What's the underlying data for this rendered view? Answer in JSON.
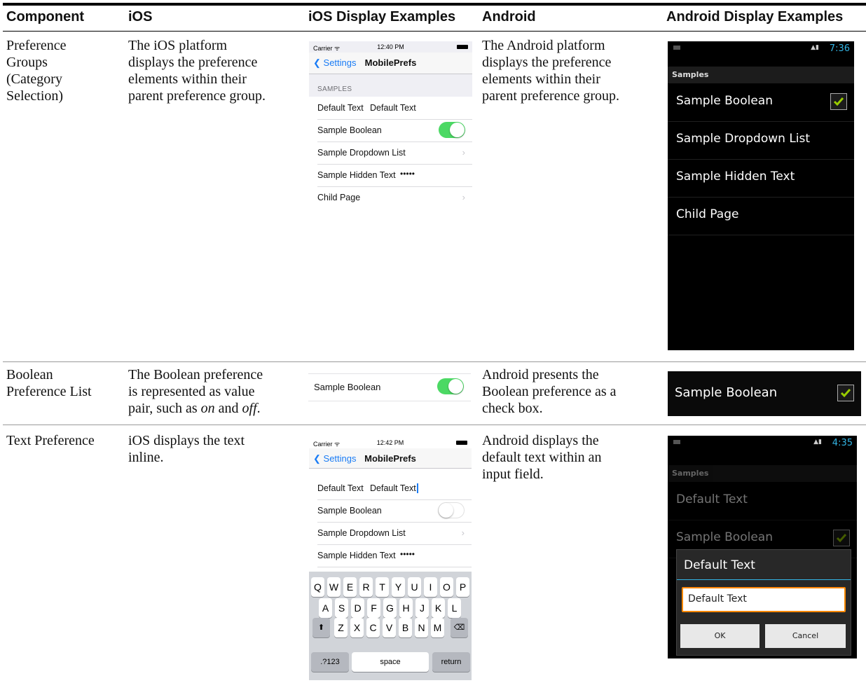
{
  "headers": {
    "component": "Component",
    "ios": "iOS",
    "ios_examples": "iOS Display Examples",
    "android": "Android",
    "android_examples": "Android Display Examples"
  },
  "rows": [
    {
      "component": [
        "Preference",
        "Groups",
        "(Category",
        "Selection)"
      ],
      "ios_desc": [
        "The iOS platform",
        "displays the preference",
        "elements within their",
        "parent preference group."
      ],
      "android_desc": [
        "The Android platform",
        "displays the preference",
        "elements within their",
        "parent preference group."
      ]
    },
    {
      "component": [
        "Boolean",
        "Preference List"
      ],
      "ios_desc_line1": "The Boolean preference",
      "ios_desc_line2": "is represented as value",
      "ios_desc_line3_pre": "pair, such as ",
      "ios_desc_on": "on",
      "ios_desc_and": " and ",
      "ios_desc_off": "off",
      "ios_desc_end": ".",
      "android_desc": [
        "Android presents the",
        "Boolean preference as a",
        "check box."
      ]
    },
    {
      "component": [
        "Text Preference"
      ],
      "ios_desc": [
        "iOS displays the text",
        "inline."
      ],
      "android_desc": [
        "Android displays the",
        "default text within an",
        "input field."
      ]
    }
  ],
  "ios_screen1": {
    "carrier": "Carrier ᯤ",
    "time": "12:40 PM",
    "back": "Settings",
    "title": "MobilePrefs",
    "section": "SAMPLES",
    "items": [
      {
        "label": "Default Text",
        "value": "Default Text"
      },
      {
        "label": "Sample Boolean"
      },
      {
        "label": "Sample Dropdown List"
      },
      {
        "label": "Sample Hidden Text",
        "value": "•••••"
      },
      {
        "label": "Child Page"
      }
    ]
  },
  "ios_boolean": {
    "label": "Sample Boolean"
  },
  "ios_screen2": {
    "carrier": "Carrier ᯤ",
    "time": "12:42 PM",
    "back": "Settings",
    "title": "MobilePrefs",
    "items": [
      {
        "label": "Default Text",
        "value": "Default Text"
      },
      {
        "label": "Sample Boolean"
      },
      {
        "label": "Sample Dropdown List"
      },
      {
        "label": "Sample Hidden Text",
        "value": "•••••"
      }
    ],
    "keyboard": {
      "row1": [
        "Q",
        "W",
        "E",
        "R",
        "T",
        "Y",
        "U",
        "I",
        "O",
        "P"
      ],
      "row2": [
        "A",
        "S",
        "D",
        "F",
        "G",
        "H",
        "J",
        "K",
        "L"
      ],
      "row3": [
        "Z",
        "X",
        "C",
        "V",
        "B",
        "N",
        "M"
      ],
      "shift": "⬆",
      "delete": "⌫",
      "numbers": ".?123",
      "space": "space",
      "return": "return"
    }
  },
  "android_screen1": {
    "time": "7:36",
    "header": "Samples",
    "items": [
      "Sample Boolean",
      "Sample Dropdown List",
      "Sample Hidden Text",
      "Child Page"
    ]
  },
  "android_boolean": {
    "label": "Sample Boolean"
  },
  "android_screen2": {
    "time": "4:35",
    "header": "Samples",
    "items": [
      "Default Text",
      "Sample Boolean"
    ],
    "dialog_title": "Default Text",
    "input_value": "Default Text",
    "ok": "OK",
    "cancel": "Cancel"
  },
  "colors": {
    "ios_blue": "#1a7cf5",
    "ios_green": "#4cd964",
    "android_blue": "#33b5e5",
    "android_check": "#99cc00",
    "android_focus": "#ff8800"
  }
}
